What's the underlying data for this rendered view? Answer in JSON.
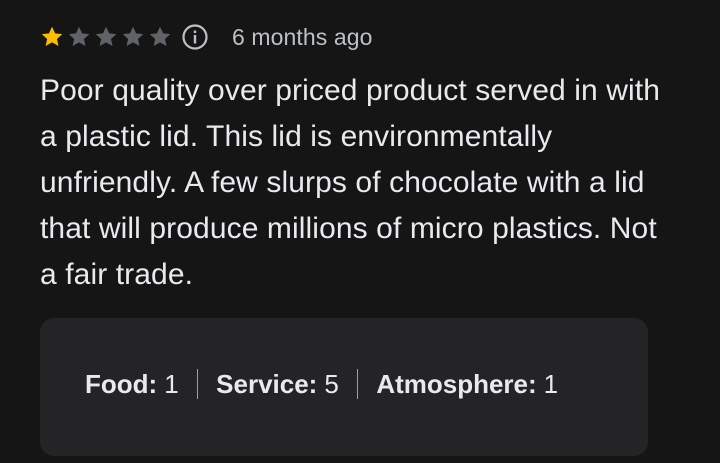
{
  "review": {
    "rating": 1,
    "max_rating": 5,
    "colors": {
      "star_filled": "#fbbc04",
      "star_empty": "#5f6368",
      "info_icon": "#bdc1c6"
    },
    "time_ago": "6 months ago",
    "info_icon": "info-circle-icon",
    "text": "Poor quality over priced product served in with a plastic lid. This lid is environmentally unfriendly. A few slurps of chocolate with a lid that will produce millions of micro plastics. Not a fair trade.",
    "subratings": [
      {
        "label": "Food:",
        "value": "1"
      },
      {
        "label": "Service:",
        "value": "5"
      },
      {
        "label": "Atmosphere:",
        "value": "1"
      }
    ]
  }
}
